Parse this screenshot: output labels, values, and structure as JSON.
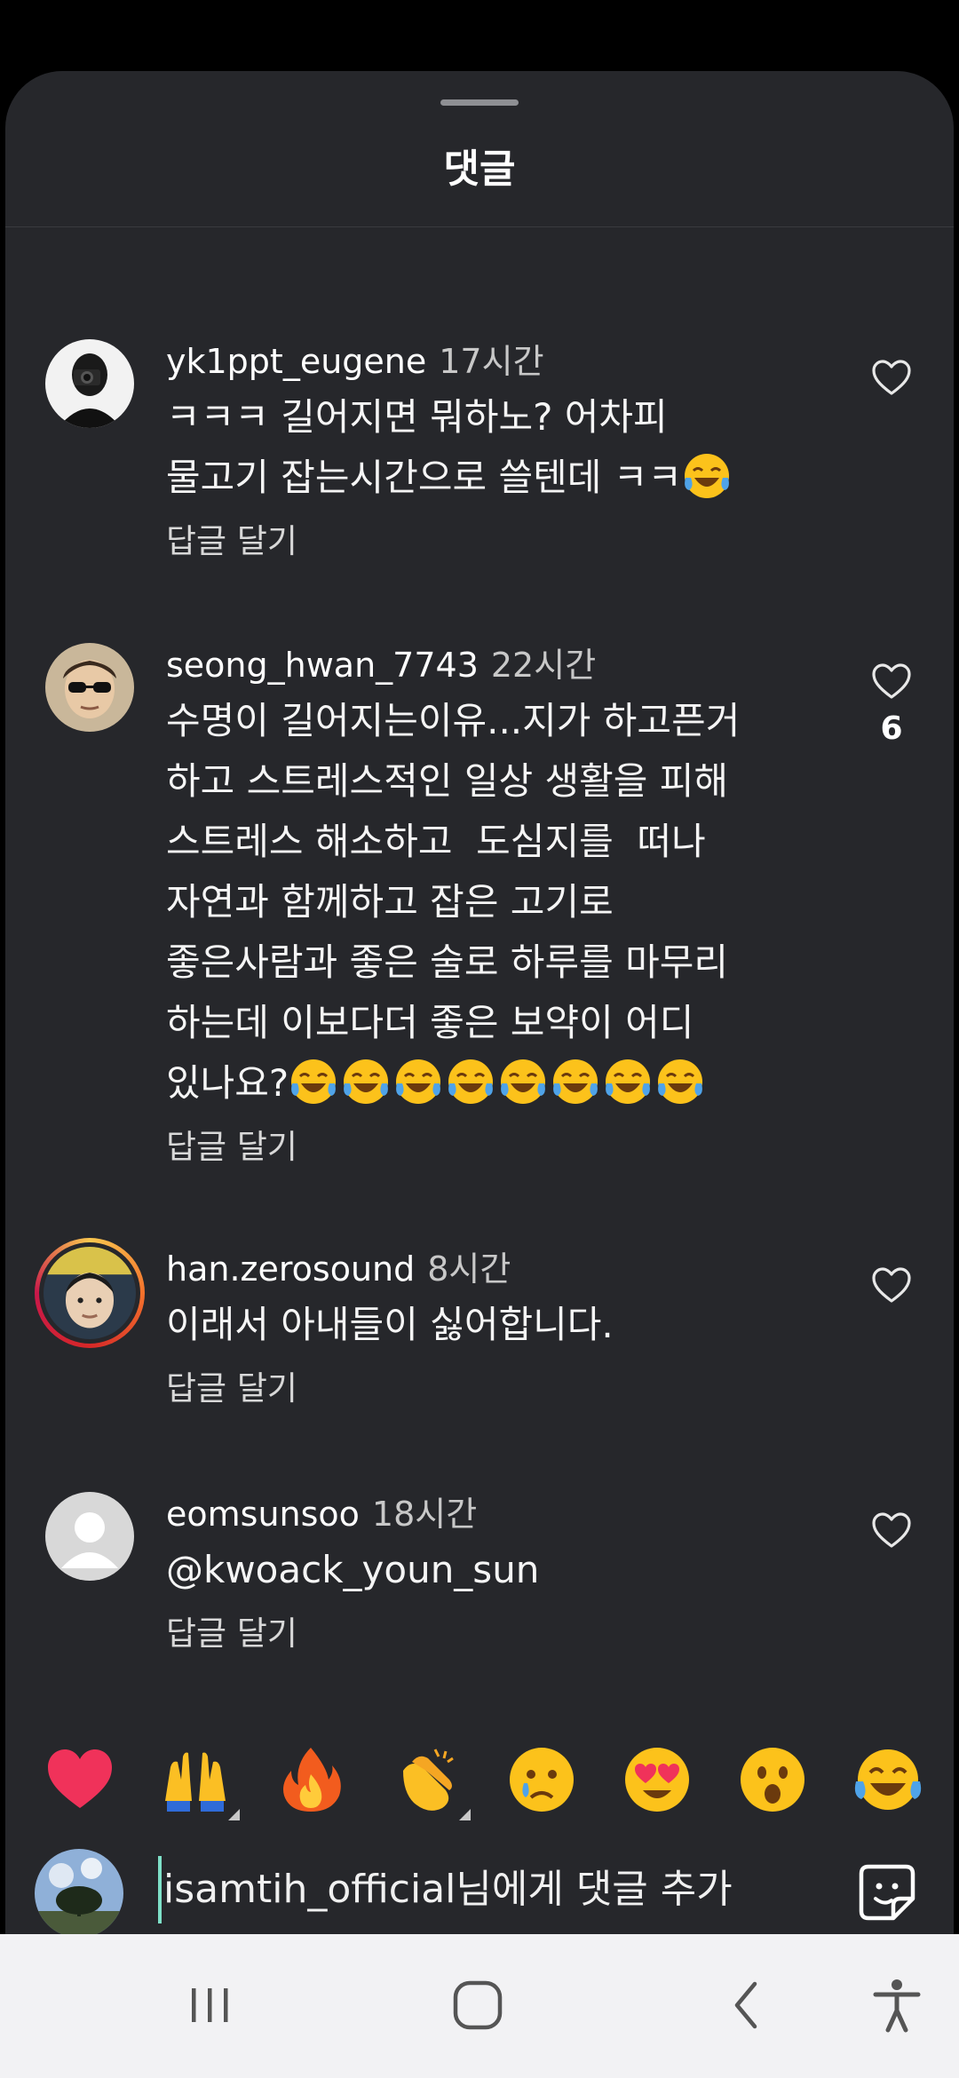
{
  "sheet": {
    "title": "댓글"
  },
  "comments": [
    {
      "username": "yk1ppt_eugene",
      "time": "17시간",
      "text_lines": [
        "ㅋㅋㅋ 길어지면 뭐하노? 어차피",
        "물고기 잡는시간으로 쓸텐데 ㅋㅋ"
      ],
      "trailing_emoji_count": 1,
      "reply_label": "답글 달기",
      "like_count": ""
    },
    {
      "username": "seong_hwan_7743",
      "time": "22시간",
      "text_lines": [
        "수명이 길어지는이유...지가 하고픈거",
        "하고 스트레스적인 일상 생활을 피해",
        "스트레스 해소하고  도심지를  떠나",
        "자연과 함께하고 잡은 고기로",
        "좋은사람과 좋은 술로 하루를 마무리",
        "하는데 이보다더 좋은 보약이 어디",
        "있나요?"
      ],
      "trailing_emoji_count": 8,
      "reply_label": "답글 달기",
      "like_count": "6"
    },
    {
      "username": "han.zerosound",
      "time": "8시간",
      "text_lines": [
        "이래서 아내들이 싫어합니다."
      ],
      "trailing_emoji_count": 0,
      "reply_label": "답글 달기",
      "like_count": ""
    },
    {
      "username": "eomsunsoo",
      "time": "18시간",
      "text_lines": [
        "@kwoack_youn_sun"
      ],
      "trailing_emoji_count": 0,
      "reply_label": "답글 달기",
      "like_count": ""
    }
  ],
  "emoji_bar": [
    "red-heart",
    "raising-hands",
    "fire",
    "clapping-hands",
    "crying-face",
    "heart-eyes",
    "surprised-face",
    "tears-of-joy"
  ],
  "composer": {
    "placeholder": "isamtih_official님에게 댓글 추가"
  },
  "colors": {
    "sheet_bg": "#26272b",
    "caret": "#7ee0c8",
    "navbar_bg": "#f2f2f4"
  }
}
